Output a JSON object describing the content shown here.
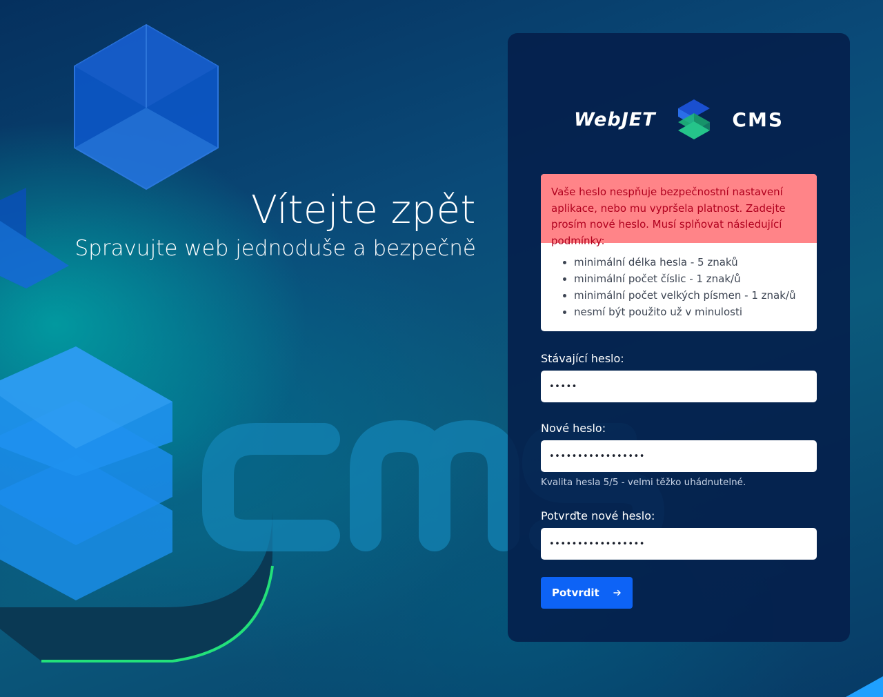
{
  "hero": {
    "title": "Vítejte zpět",
    "subtitle": "Spravujte web jednoduše a bezpečně"
  },
  "brand": {
    "left_text": "WebJET",
    "right_text": "CMS",
    "icon": "webjet-logo-icon"
  },
  "alert": {
    "message": "Vaše heslo nespňuje bezpečnostní nastavení aplikace, nebo mu vypršela platnost. Zadejte prosím nové heslo. Musí splňovat následující podmínky:",
    "rules": [
      "minimální délka hesla - 5 znaků",
      "minimální počet číslic - 1 znak/ů",
      "minimální počet velkých písmen - 1 znak/ů",
      "nesmí být použito už v minulosti"
    ]
  },
  "form": {
    "current_label": "Stávající heslo:",
    "current_value": "•••••",
    "new_label": "Nové heslo:",
    "new_value": "•••••••••••••••••",
    "new_hint": "Kvalita hesla 5/5 - velmi těžko uhádnutelné.",
    "confirm_label": "Potvrďte nové heslo:",
    "confirm_value": "•••••••••••••••••",
    "submit_label": "Potvrdit",
    "submit_icon": "arrow-right-icon"
  },
  "colors": {
    "panel": "#041e4a",
    "alert_header_bg": "#ff8488",
    "alert_text": "#b0001e",
    "button": "#0d63f6"
  }
}
